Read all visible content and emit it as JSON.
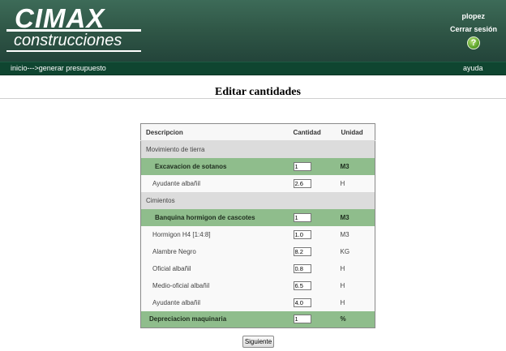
{
  "brand": {
    "name": "CIMAX",
    "tagline": "construcciones"
  },
  "header": {
    "user": "plopez",
    "logout_label": "Cerrar sesión",
    "help_icon_glyph": "?"
  },
  "nav": {
    "breadcrumb": "inicio--->generar presupuesto",
    "help_label": "ayuda"
  },
  "page": {
    "title": "Editar cantidades"
  },
  "table": {
    "headers": {
      "description": "Descripcion",
      "quantity": "Cantidad",
      "unit": "Unidad"
    },
    "rows": [
      {
        "type": "group",
        "description": "Movimiento de tierra"
      },
      {
        "type": "highlight",
        "description": "Excavacion de sotanos",
        "quantity": "1",
        "unit": "M3"
      },
      {
        "type": "item",
        "description": "Ayudante albañil",
        "quantity": "2.6",
        "unit": "H"
      },
      {
        "type": "group",
        "description": "Cimientos"
      },
      {
        "type": "highlight",
        "description": "Banquina hormigon de cascotes",
        "quantity": "1",
        "unit": "M3"
      },
      {
        "type": "item",
        "description": "Hormigon H4 [1:4:8]",
        "quantity": "1.0",
        "unit": "M3"
      },
      {
        "type": "item",
        "description": "Alambre Negro",
        "quantity": "8.2",
        "unit": "KG"
      },
      {
        "type": "item",
        "description": "Oficial albañil",
        "quantity": "0.8",
        "unit": "H"
      },
      {
        "type": "item",
        "description": "Medio-oficial albañil",
        "quantity": "6.5",
        "unit": "H"
      },
      {
        "type": "item",
        "description": "Ayudante albañil",
        "quantity": "4.0",
        "unit": "H"
      },
      {
        "type": "highlight-top",
        "description": "Depreciacion maquinaria",
        "quantity": "1",
        "unit": "%"
      }
    ]
  },
  "actions": {
    "next_label": "Siguiente"
  },
  "colors": {
    "header_green": "#2f5646",
    "nav_green": "#0f4530",
    "highlight_green": "#8fbd8c",
    "group_gray": "#dcdcdc"
  }
}
